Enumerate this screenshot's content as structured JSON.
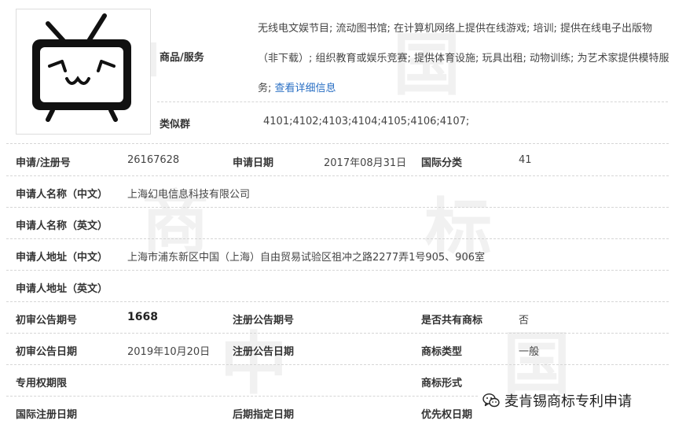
{
  "goods_services": {
    "label": "商品/服务",
    "text": "无线电文娱节目; 流动图书馆; 在计算机网络上提供在线游戏; 培训; 提供在线电子出版物（非下载）; 组织教育或娱乐竞赛; 提供体育设施; 玩具出租; 动物训练; 为艺术家提供模特服务;",
    "more_link": "查看详细信息"
  },
  "similar_group": {
    "label": "类似群",
    "value": "4101;4102;4103;4104;4105;4106;4107;"
  },
  "rows": [
    {
      "cells": [
        {
          "label": "申请/注册号",
          "value": "26167628"
        },
        {
          "label": "申请日期",
          "value": "2017年08月31日"
        },
        {
          "label": "国际分类",
          "value": "41"
        }
      ]
    },
    {
      "cells": [
        {
          "label": "申请人名称（中文）",
          "value": "上海幻电信息科技有限公司"
        }
      ]
    },
    {
      "cells": [
        {
          "label": "申请人名称（英文）",
          "value": ""
        }
      ]
    },
    {
      "cells": [
        {
          "label": "申请人地址（中文）",
          "value": "上海市浦东新区中国（上海）自由贸易试验区祖冲之路2277弄1号905、906室"
        }
      ]
    },
    {
      "cells": [
        {
          "label": "申请人地址（英文）",
          "value": ""
        }
      ]
    },
    {
      "cells": [
        {
          "label": "初审公告期号",
          "value": "1668"
        },
        {
          "label": "注册公告期号",
          "value": ""
        },
        {
          "label": "是否共有商标",
          "value": "否"
        }
      ]
    },
    {
      "cells": [
        {
          "label": "初审公告日期",
          "value": "2019年10月20日"
        },
        {
          "label": "注册公告日期",
          "value": ""
        },
        {
          "label": "商标类型",
          "value": "一般"
        }
      ]
    },
    {
      "cells": [
        {
          "label": "专用权期限",
          "value": ""
        },
        {
          "label": "商标形式",
          "value": ""
        }
      ]
    },
    {
      "cells": [
        {
          "label": "国际注册日期",
          "value": ""
        },
        {
          "label": "后期指定日期",
          "value": ""
        },
        {
          "label": "优先权日期",
          "value": ""
        }
      ]
    }
  ],
  "watermark": {
    "chars": [
      "中",
      "国",
      "商",
      "标",
      "中",
      "国"
    ]
  },
  "badge": {
    "text": "麦肯锡商标专利申请",
    "icon": "wechat-icon"
  }
}
